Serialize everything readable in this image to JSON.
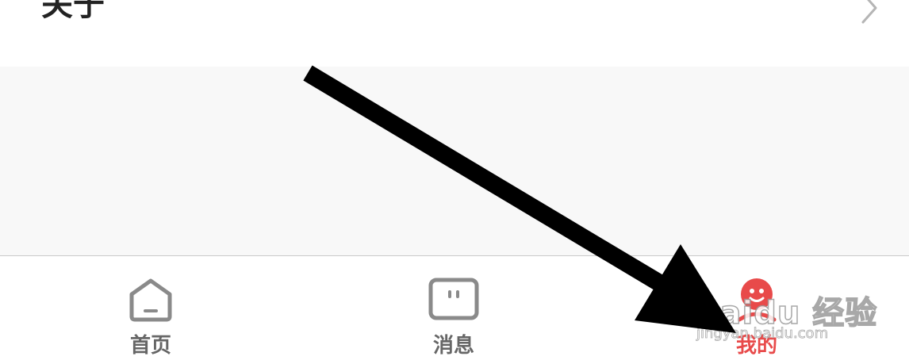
{
  "settings_row": {
    "label": "关于",
    "chevron_icon": "chevron-right-icon"
  },
  "tabbar": {
    "tabs": [
      {
        "label": "首页",
        "icon": "home-icon",
        "active": false
      },
      {
        "label": "消息",
        "icon": "message-icon",
        "active": false
      },
      {
        "label": "我的",
        "icon": "profile-icon",
        "active": true
      }
    ]
  },
  "watermark": {
    "brand": "Baidu 经验",
    "url": "jingyan.baidu.com"
  },
  "colors": {
    "active_tab": "#e84a4a",
    "inactive_tab": "#666666",
    "arrow": "#000000"
  }
}
